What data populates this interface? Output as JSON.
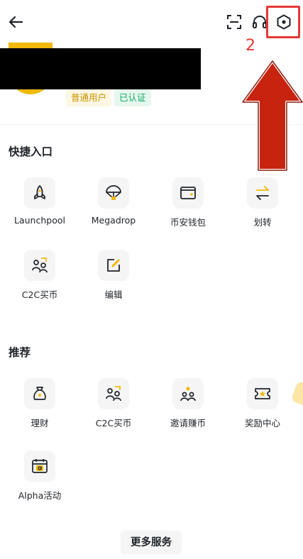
{
  "header": {
    "back_icon": "arrow-left-icon",
    "scan_icon": "scan-icon",
    "support_icon": "headset-icon",
    "settings_icon": "hexagon-settings-icon",
    "step_number": "2"
  },
  "profile": {
    "user_type": "普通用户",
    "verified": "已认证"
  },
  "quick_access": {
    "title": "快捷入口",
    "items": [
      {
        "label": "Launchpool",
        "icon": "rocket-icon"
      },
      {
        "label": "Megadrop",
        "icon": "parachute-icon"
      },
      {
        "label": "币安钱包",
        "icon": "wallet-icon"
      },
      {
        "label": "划转",
        "icon": "transfer-icon"
      },
      {
        "label": "C2C买币",
        "icon": "c2c-icon"
      },
      {
        "label": "编辑",
        "icon": "edit-icon"
      }
    ]
  },
  "recommended": {
    "title": "推荐",
    "items": [
      {
        "label": "理财",
        "icon": "money-bag-icon"
      },
      {
        "label": "C2C买币",
        "icon": "c2c-icon"
      },
      {
        "label": "邀请赚币",
        "icon": "invite-icon"
      },
      {
        "label": "奖励中心",
        "icon": "ticket-icon"
      },
      {
        "label": "Alpha活动",
        "icon": "calendar-alpha-icon"
      }
    ]
  },
  "more_services": "更多服务",
  "colors": {
    "accent": "#f0b90b",
    "highlight": "#e53935",
    "arrow_fill": "#c8230f",
    "verified_text": "#0eaa62",
    "user_badge_text": "#c99400"
  }
}
